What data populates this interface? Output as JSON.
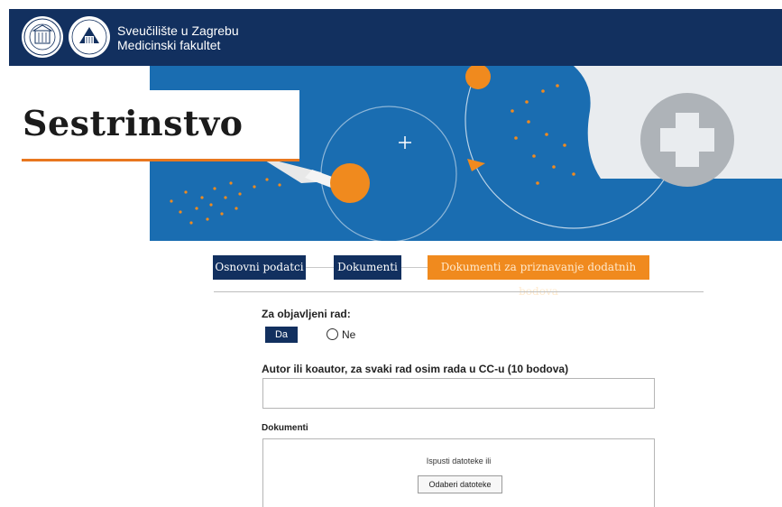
{
  "header": {
    "university_line1": "Sveučilište u Zagrebu",
    "university_line2": "Medicinski fakultet",
    "background_color": "#12305f"
  },
  "banner": {
    "title": "Sestrinstvo",
    "accent_color": "#e8771f",
    "background_color": "#1a73b8"
  },
  "stepper": {
    "steps": [
      {
        "label": "Osnovni podatci",
        "state": "done"
      },
      {
        "label": "Dokumenti",
        "state": "done"
      },
      {
        "label": "Dokumenti za priznavanje dodatnih bodova",
        "state": "active"
      }
    ],
    "active_color": "#f08a1e"
  },
  "form": {
    "published_paper": {
      "label": "Za objavljeni rad:",
      "yes_label": "Da",
      "no_label": "Ne",
      "selected": "Da"
    },
    "author_field": {
      "label": "Autor ili koautor, za svaki rad osim rada u CC-u (10 bodova)",
      "value": ""
    },
    "documents": {
      "label": "Dokumenti",
      "drop_text": "Ispusti datoteke ili",
      "choose_button": "Odaberi datoteke"
    }
  }
}
